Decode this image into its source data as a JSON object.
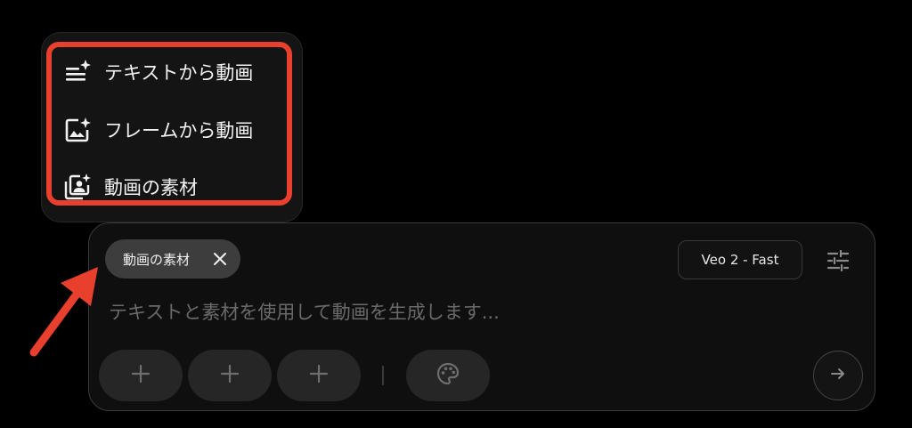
{
  "menu": {
    "items": [
      {
        "label": "テキストから動画",
        "icon": "text-lines-sparkle-icon"
      },
      {
        "label": "フレームから動画",
        "icon": "image-sparkle-icon"
      },
      {
        "label": "動画の素材",
        "icon": "ingredients-portrait-icon"
      }
    ]
  },
  "composer": {
    "chip_label": "動画の素材",
    "model_label": "Veo 2 - Fast",
    "prompt_placeholder": "テキストと素材を使用して動画を生成します...",
    "add_buttons": [
      "+",
      "+",
      "+"
    ]
  },
  "colors": {
    "highlight": "#e8402c",
    "background": "#000000",
    "panel": "#0f0f0f",
    "chip": "#3d3d3d"
  }
}
